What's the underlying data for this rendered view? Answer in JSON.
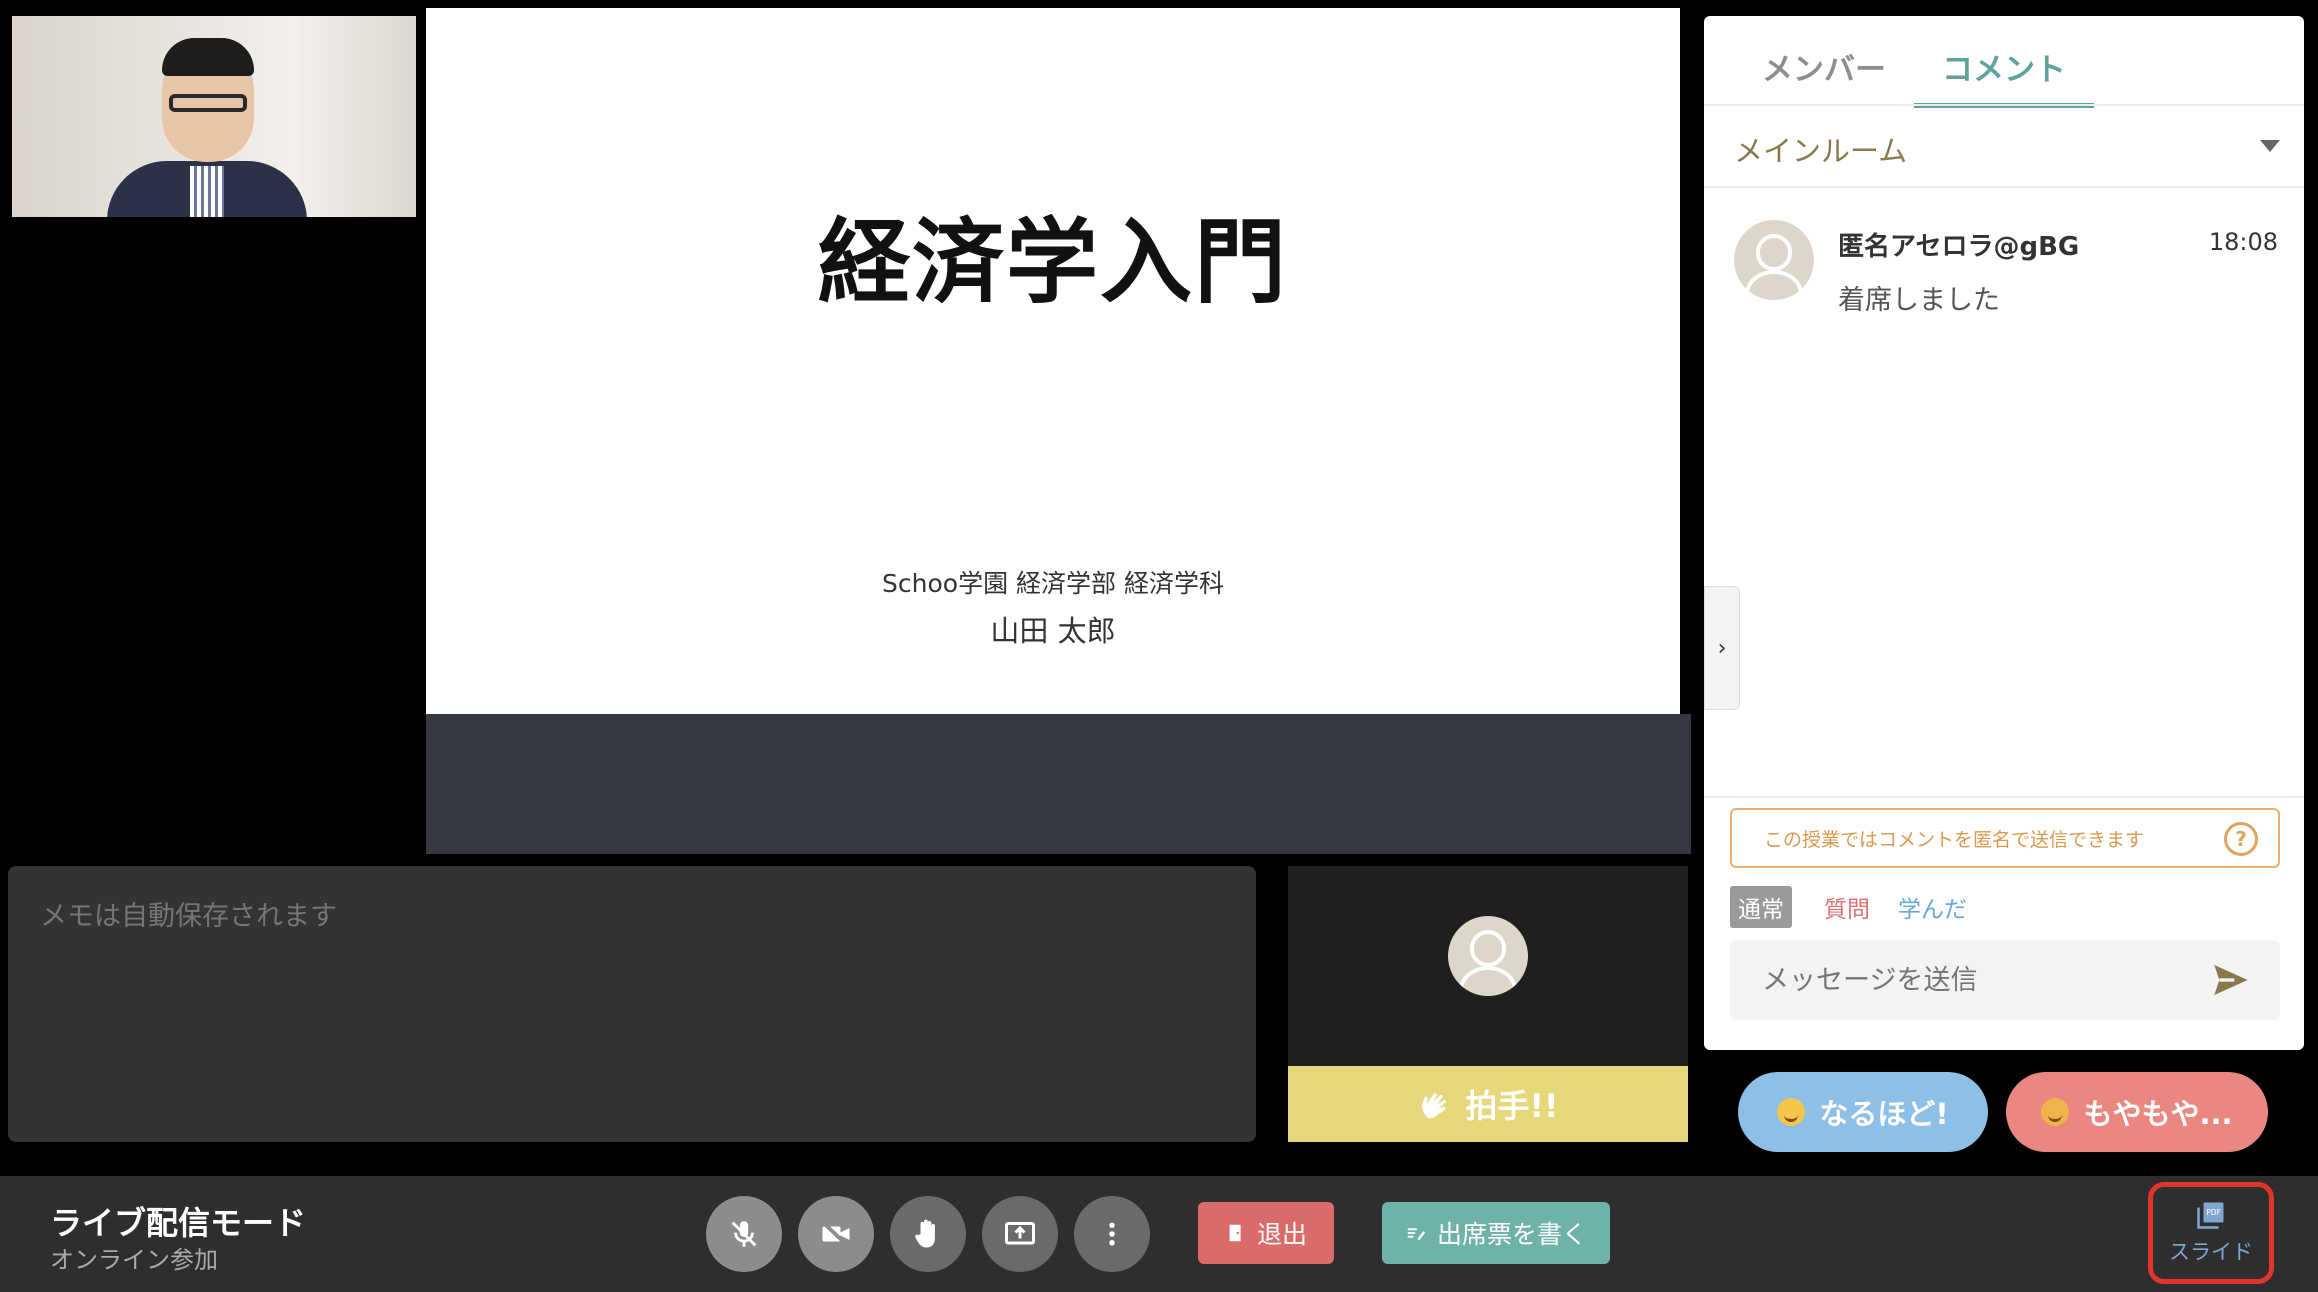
{
  "slide": {
    "title": "経済学入門",
    "subtitle": "Schoo学園 経済学部 経済学科",
    "presenter": "山田 太郎"
  },
  "memo": {
    "placeholder": "メモは自動保存されます"
  },
  "participant_tile": {
    "clap_label": "拍手!!"
  },
  "chat": {
    "tabs": [
      "メンバー",
      "コメント"
    ],
    "active_tab": "コメント",
    "room": "メインルーム",
    "comments": [
      {
        "author": "匿名アセロラ@gBG",
        "time": "18:08",
        "text": "着席しました"
      }
    ],
    "anonymous_notice": "この授業ではコメントを匿名で送信できます",
    "help_icon": "question-circle-icon",
    "comment_types": [
      "通常",
      "質問",
      "学んだ"
    ],
    "message_placeholder": "メッセージを送信"
  },
  "reactions": {
    "naruhodo": "なるほど!",
    "moyamoya": "もやもや..."
  },
  "bottom_bar": {
    "mode_title": "ライブ配信モード",
    "mode_sub": "オンライン参加",
    "exit_label": "退出",
    "attendance_label": "出席票を書く",
    "slide_label": "スライド",
    "slide_icon_text": "PDF"
  },
  "colors": {
    "accent_teal": "#5ea39c",
    "exit_red": "#db6b6b",
    "attend_green": "#6fb3a8",
    "clap_yellow": "#e6d77a",
    "highlight_red": "#e0352b"
  }
}
